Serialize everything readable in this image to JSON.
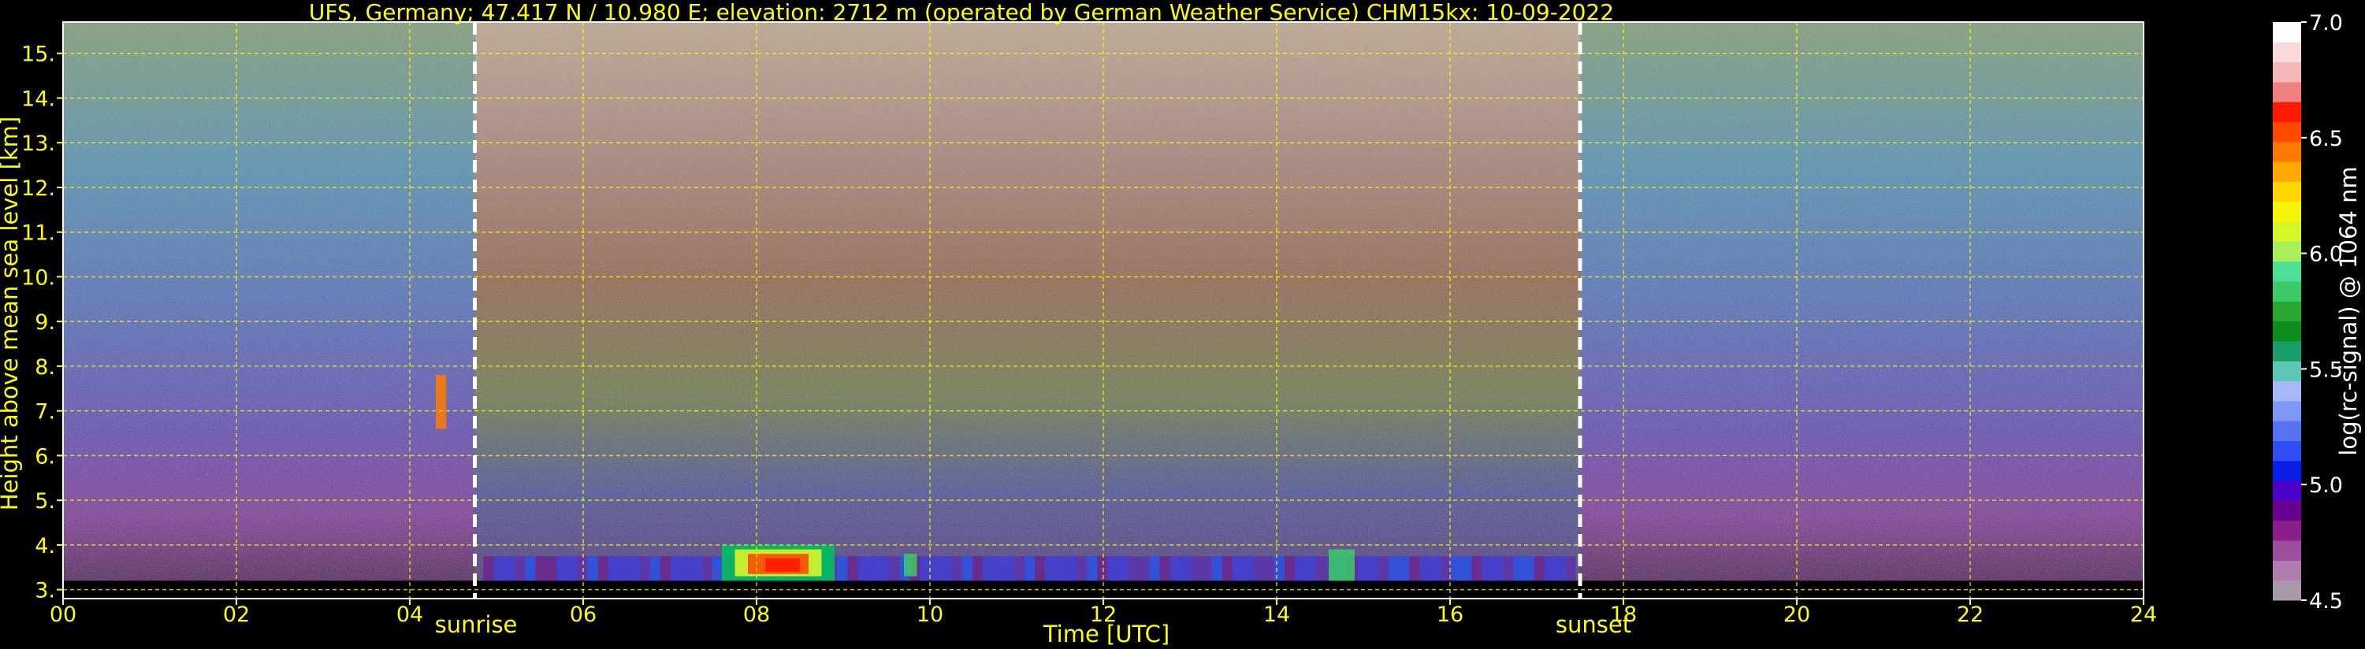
{
  "chart_data": {
    "type": "heatmap",
    "title": "UFS, Germany; 47.417 N / 10.980 E; elevation: 2712 m  (operated by German Weather Service)    CHM15kx: 10-09-2022",
    "xlabel": "Time [UTC]",
    "ylabel": "Height above mean sea level [km]",
    "xlim": [
      0,
      24
    ],
    "ylim": [
      2.8,
      15.7
    ],
    "x_ticks": [
      "00",
      "02",
      "04",
      "06",
      "08",
      "10",
      "12",
      "14",
      "16",
      "18",
      "20",
      "22",
      "24"
    ],
    "x_tick_values": [
      0,
      2,
      4,
      6,
      8,
      10,
      12,
      14,
      16,
      18,
      20,
      22,
      24
    ],
    "y_ticks": [
      "3.",
      "4.",
      "5.",
      "6.",
      "7.",
      "8.",
      "9.",
      "10.",
      "11.",
      "12.",
      "13.",
      "14.",
      "15."
    ],
    "y_tick_values": [
      3,
      4,
      5,
      6,
      7,
      8,
      9,
      10,
      11,
      12,
      13,
      14,
      15
    ],
    "grid": true,
    "grid_color": "#ffff00",
    "annotations": [
      {
        "text": "sunrise",
        "x": 4.75
      },
      {
        "text": "sunset",
        "x": 17.5
      }
    ],
    "colorbar": {
      "label": "log(rc-signal) @ 1064 nm",
      "range": [
        4.5,
        7.0
      ],
      "ticks": [
        "7.0",
        "6.5",
        "6.0",
        "5.5",
        "5.0",
        "4.5"
      ],
      "tick_values": [
        7.0,
        6.5,
        6.0,
        5.5,
        5.0,
        4.5
      ],
      "colors": [
        "#a89aa8",
        "#b07fb0",
        "#9d4f9d",
        "#8a1f8a",
        "#6a0090",
        "#4b00c8",
        "#0a1ee6",
        "#2f4df0",
        "#5873f2",
        "#7e97f5",
        "#a7b8f8",
        "#5fc7b8",
        "#1a9f6a",
        "#0e8c1e",
        "#2aa830",
        "#3ccb6a",
        "#4fe098",
        "#a8f05a",
        "#d8f52a",
        "#f5f50a",
        "#ffd600",
        "#ffaa00",
        "#ff7b00",
        "#ff4a00",
        "#ff1a00",
        "#f08080",
        "#f4b8b8",
        "#f8dada",
        "#ffffff"
      ]
    },
    "background_levels": [
      {
        "h": 15.5,
        "color": "#7a9a70"
      },
      {
        "h": 12.5,
        "color": "#4a8cb0"
      },
      {
        "h": 9.5,
        "color": "#4a66b8"
      },
      {
        "h": 7.0,
        "color": "#5a3fb0"
      },
      {
        "h": 5.0,
        "color": "#7a2e90"
      },
      {
        "h": 3.2,
        "color": "#6a1f70"
      }
    ]
  }
}
